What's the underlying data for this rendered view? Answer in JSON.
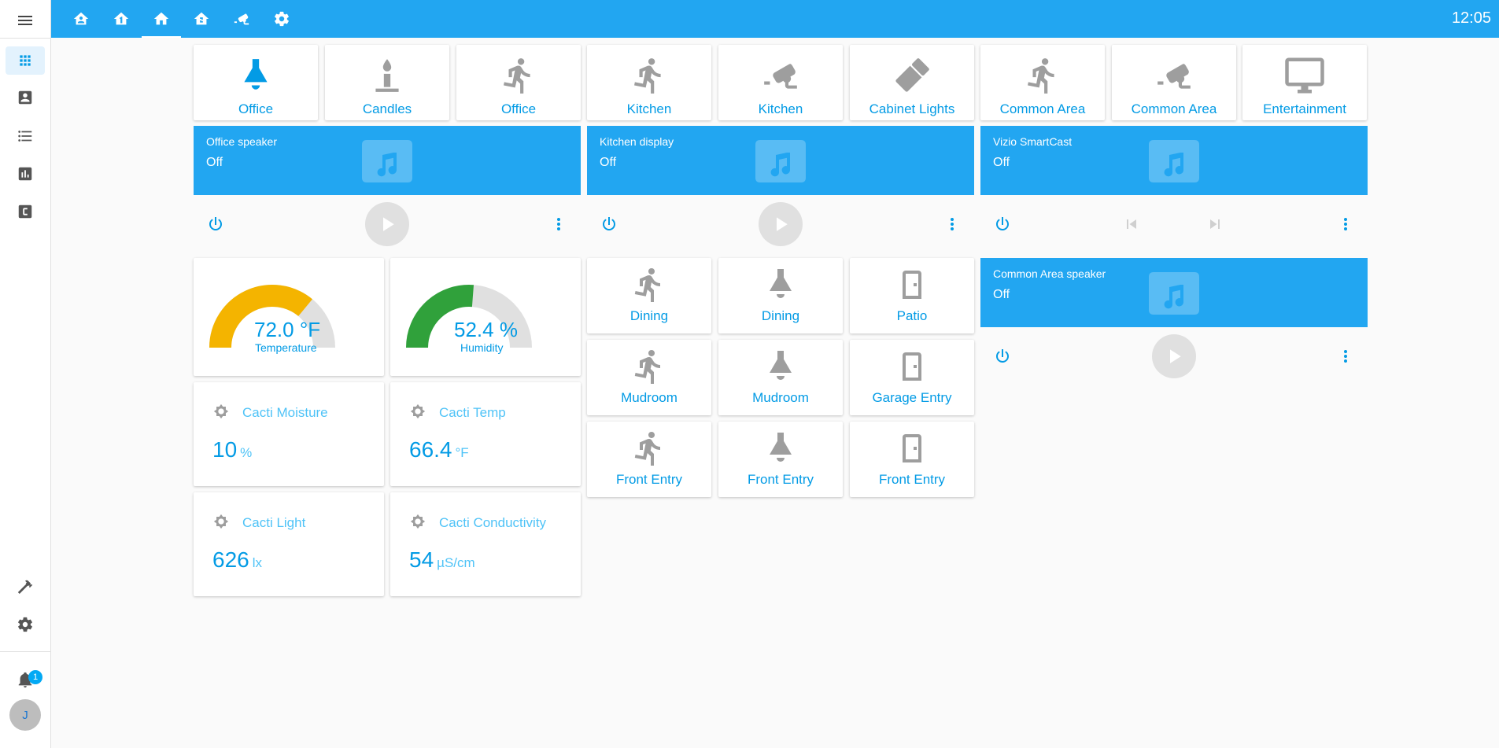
{
  "colors": {
    "accent": "#22a6f1",
    "brand": "#039be5",
    "gauge_temperature": "#f4b400",
    "gauge_humidity": "#30a13b"
  },
  "topbar": {
    "clock": "12:05"
  },
  "sidebar": {
    "notification_count": "1",
    "avatar_initial": "J"
  },
  "buttons_row": [
    {
      "label": "Office",
      "icon": "ceiling-light-on-icon"
    },
    {
      "label": "Candles",
      "icon": "candle-icon"
    },
    {
      "label": "Office",
      "icon": "motion-sensor-icon"
    },
    {
      "label": "Kitchen",
      "icon": "motion-sensor-icon"
    },
    {
      "label": "Kitchen",
      "icon": "cctv-camera-icon"
    },
    {
      "label": "Cabinet Lights",
      "icon": "led-strip-icon"
    },
    {
      "label": "Common Area",
      "icon": "motion-sensor-icon"
    },
    {
      "label": "Common Area",
      "icon": "cctv-camera-icon"
    },
    {
      "label": "Entertainment",
      "icon": "monitor-icon"
    }
  ],
  "media": [
    {
      "name": "Office speaker",
      "state": "Off"
    },
    {
      "name": "Kitchen display",
      "state": "Off"
    },
    {
      "name": "Vizio SmartCast",
      "state": "Off"
    },
    {
      "name": "Common Area speaker",
      "state": "Off"
    }
  ],
  "gauges": [
    {
      "value": "72.0 °F",
      "name": "Temperature",
      "level": 0.72
    },
    {
      "value": "52.4 %",
      "name": "Humidity",
      "level": 0.524
    }
  ],
  "sensors": [
    {
      "title": "Cacti Moisture",
      "value": "10",
      "unit": "%"
    },
    {
      "title": "Cacti Temp",
      "value": "66.4",
      "unit": "°F"
    },
    {
      "title": "Cacti Light",
      "value": "626",
      "unit": "lx"
    },
    {
      "title": "Cacti Conductivity",
      "value": "54",
      "unit": "µS/cm"
    }
  ],
  "grid_buttons": [
    {
      "label": "Dining",
      "icon": "motion-sensor-icon"
    },
    {
      "label": "Dining",
      "icon": "ceiling-light-icon"
    },
    {
      "label": "Patio",
      "icon": "door-icon"
    },
    {
      "label": "Mudroom",
      "icon": "motion-sensor-icon"
    },
    {
      "label": "Mudroom",
      "icon": "ceiling-light-icon"
    },
    {
      "label": "Garage Entry",
      "icon": "door-icon"
    },
    {
      "label": "Front Entry",
      "icon": "motion-sensor-icon"
    },
    {
      "label": "Front Entry",
      "icon": "ceiling-light-icon"
    },
    {
      "label": "Front Entry",
      "icon": "door-icon"
    }
  ]
}
